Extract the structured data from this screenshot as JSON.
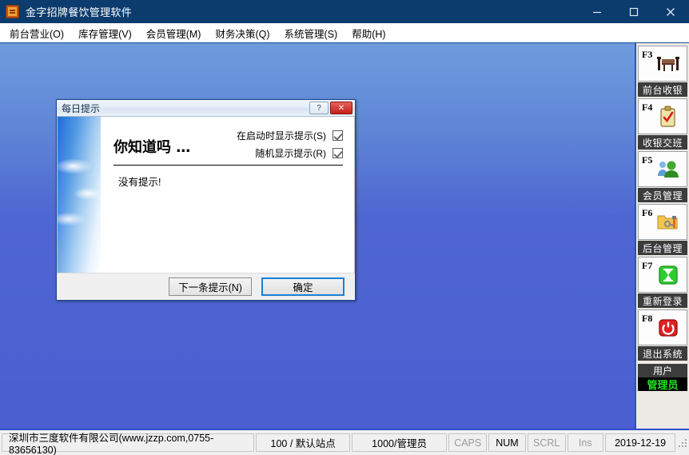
{
  "window": {
    "title": "金字招牌餐饮管理软件",
    "icon": "app-logo-icon",
    "controls": {
      "minimize": "minimize-icon",
      "maximize": "maximize-icon",
      "close": "close-icon"
    },
    "titlebar_color": "#0c3c6e"
  },
  "menubar": {
    "items": [
      {
        "label": "前台营业(O)"
      },
      {
        "label": "库存管理(V)"
      },
      {
        "label": "会员管理(M)"
      },
      {
        "label": "财务决策(Q)"
      },
      {
        "label": "系统管理(S)"
      },
      {
        "label": "帮助(H)"
      }
    ]
  },
  "sidebar": {
    "buttons": [
      {
        "fkey": "F3",
        "label": "前台收银",
        "icon": "dining-table-icon"
      },
      {
        "fkey": "F4",
        "label": "收银交班",
        "icon": "clipboard-check-icon"
      },
      {
        "fkey": "F5",
        "label": "会员管理",
        "icon": "users-icon"
      },
      {
        "fkey": "F6",
        "label": "后台管理",
        "icon": "folder-tools-icon"
      },
      {
        "fkey": "F7",
        "label": "重新登录",
        "icon": "hourglass-icon"
      },
      {
        "fkey": "F8",
        "label": "退出系统",
        "icon": "power-icon"
      }
    ],
    "user_panel": {
      "title": "用户",
      "name": "管理员",
      "name_color": "#22e022"
    }
  },
  "dialog": {
    "title": "每日提示",
    "help_button": "?",
    "close_button": "✕",
    "heading": "你知道吗 …",
    "options": [
      {
        "label": "在启动时显示提示(S)",
        "checked": true
      },
      {
        "label": "随机显示提示(R)",
        "checked": true
      }
    ],
    "tip_text": "没有提示!",
    "buttons": [
      {
        "label": "下一条提示(N)",
        "default": false
      },
      {
        "label": "确定",
        "default": true
      }
    ]
  },
  "statusbar": {
    "company": "深圳市三度软件有限公司(www.jzzp.com,0755-83656130)",
    "station": "100 / 默认站点",
    "user": "1000/管理员",
    "keys": [
      {
        "label": "CAPS",
        "active": false
      },
      {
        "label": "NUM",
        "active": true
      },
      {
        "label": "SCRL",
        "active": false
      },
      {
        "label": "Ins",
        "active": false
      }
    ],
    "date": "2019-12-19",
    "grip": "resize-grip-icon"
  }
}
